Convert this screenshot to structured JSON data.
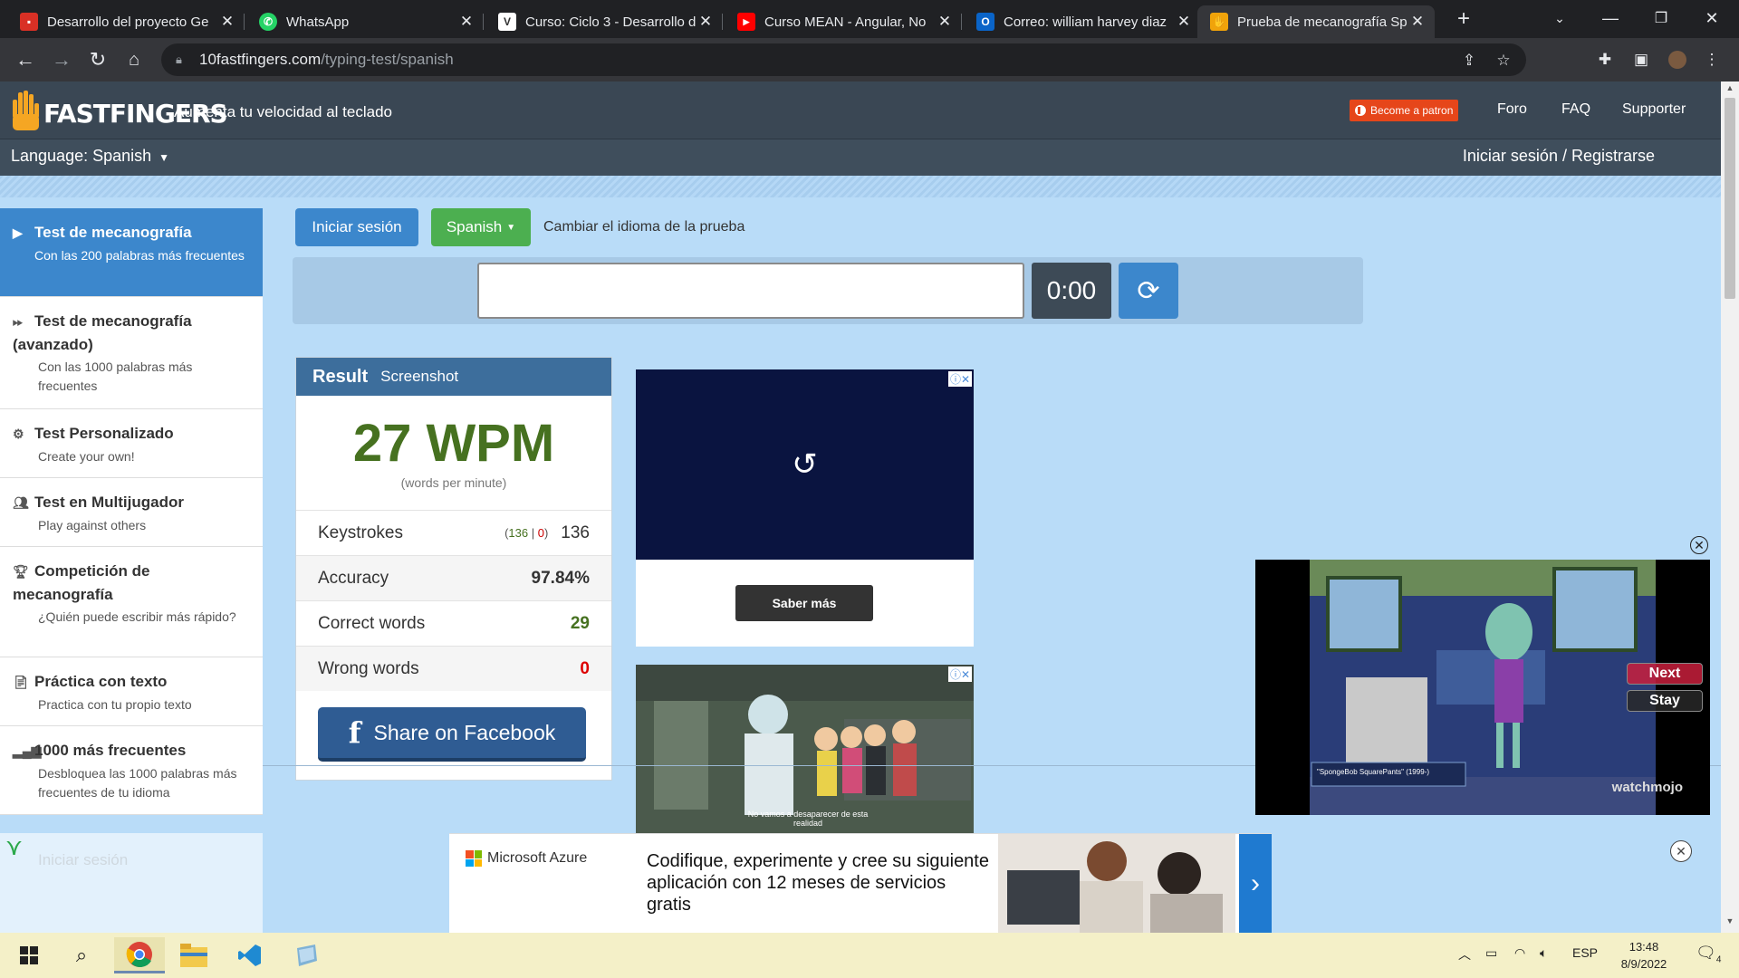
{
  "browser": {
    "tabs": [
      {
        "title": "Desarrollo del proyecto Ge",
        "favicon": "docs",
        "color": "#d93025"
      },
      {
        "title": "WhatsApp",
        "favicon": "whatsapp",
        "color": "#25d366"
      },
      {
        "title": "Curso: Ciclo 3 - Desarrollo d",
        "favicon": "moodle",
        "color": "#ffffff"
      },
      {
        "title": "Curso MEAN - Angular, No",
        "favicon": "youtube",
        "color": "#ff0000"
      },
      {
        "title": "Correo: william harvey diaz",
        "favicon": "outlook",
        "color": "#0a64c8"
      },
      {
        "title": "Prueba de mecanografía Sp",
        "favicon": "10fastfingers",
        "color": "#f0a30a"
      }
    ],
    "url_host": "10fastfingers.com",
    "url_path": "/typing-test/spanish"
  },
  "site": {
    "logo_text": "FASTFINGERS",
    "tagline": "Aumenta tu velocidad al teclado",
    "patron_label": "Become a patron",
    "nav": [
      "Foro",
      "FAQ",
      "Supporter"
    ],
    "language_label": "Language: Spanish",
    "login_register": "Iniciar sesión / Registrarse"
  },
  "sidebar": {
    "items": [
      {
        "title": "Test de mecanografía",
        "sub": "Con las 200 palabras más frecuentes",
        "icon": "play-icon"
      },
      {
        "title": "Test de mecanografía (avanzado)",
        "sub": "Con las 1000 palabras más frecuentes",
        "icon": "fast-forward-icon"
      },
      {
        "title": "Test Personalizado",
        "sub": "Create your own!",
        "icon": "gears-icon"
      },
      {
        "title": "Test en Multijugador",
        "sub": "Play against others",
        "icon": "users-icon"
      },
      {
        "title": "Competición de mecanografía",
        "sub": "¿Quién puede escribir más rápido?",
        "icon": "trophy-icon"
      },
      {
        "title": "Práctica con texto",
        "sub": "Practica con tu propio texto",
        "icon": "file-icon"
      },
      {
        "title": "1000 más frecuentes",
        "sub": "Desbloquea las 1000 palabras más frecuentes de tu idioma",
        "icon": "signal-icon"
      }
    ],
    "ghost_login": "Iniciar sesión"
  },
  "main": {
    "login_button": "Iniciar sesión",
    "language_button": "Spanish",
    "language_hint": "Cambiar el idioma de la prueba",
    "input_value": "",
    "timer": "0:00"
  },
  "result": {
    "tab_result": "Result",
    "tab_screenshot": "Screenshot",
    "wpm": "27 WPM",
    "wpm_sub": "(words per minute)",
    "keystrokes_label": "Keystrokes",
    "keystrokes_correct": "136",
    "keystrokes_wrong": "0",
    "keystrokes_total": "136",
    "accuracy_label": "Accuracy",
    "accuracy_value": "97.84%",
    "correct_label": "Correct words",
    "correct_value": "29",
    "wrong_label": "Wrong words",
    "wrong_value": "0",
    "share_label": "Share on Facebook"
  },
  "ads": {
    "video_ad_button": "Saber más",
    "rick_caption": "No vamos a desaparecer de esta realidad",
    "video_next": "Next",
    "video_stay": "Stay",
    "video_caption": "\"SpongeBob SquarePants\" (1999-)",
    "video_watermark": "watchmojo",
    "azure_brand": "Microsoft Azure",
    "azure_copy": "Codifique, experimente y cree su siguiente aplicación con 12 meses de servicios gratis"
  },
  "taskbar": {
    "language": "ESP",
    "time": "13:48",
    "date": "8/9/2022",
    "notifications": "4"
  }
}
